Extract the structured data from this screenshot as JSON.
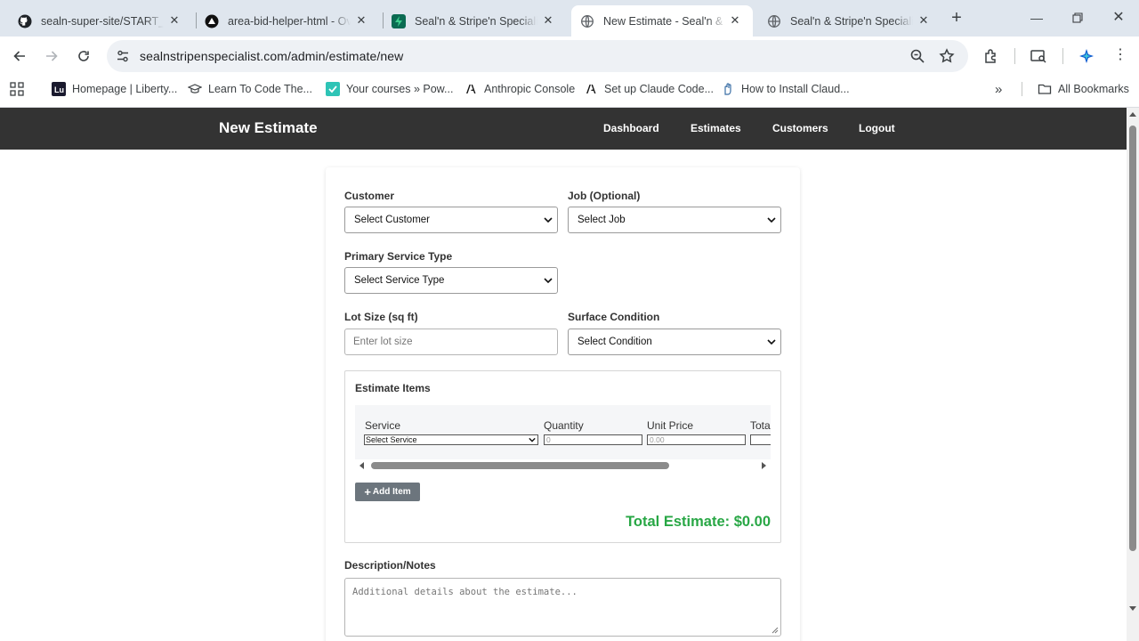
{
  "browser": {
    "tabs": [
      {
        "title": "sealn-super-site/START_TO",
        "icon": "github-icon",
        "active": false
      },
      {
        "title": "area-bid-helper-html - Ov",
        "icon": "vercel-icon",
        "active": false
      },
      {
        "title": "Seal'n & Stripe'n Specialist",
        "icon": "supabase-icon",
        "active": false
      },
      {
        "title": "New Estimate - Seal'n & St",
        "icon": "globe-icon",
        "active": true
      },
      {
        "title": "Seal'n & Stripe'n Specialist",
        "icon": "globe-icon",
        "active": false
      }
    ],
    "url": "sealnstripenspecialist.com/admin/estimate/new",
    "bookmarks": [
      {
        "label": "Homepage | Liberty...",
        "icon": "liberty-icon"
      },
      {
        "label": "Learn To Code The...",
        "icon": "graduation-cap-icon"
      },
      {
        "label": "Your courses » Pow...",
        "icon": "course-icon"
      },
      {
        "label": "Anthropic Console",
        "icon": "anthropic-icon"
      },
      {
        "label": "Set up Claude Code...",
        "icon": "anthropic-icon"
      },
      {
        "label": "How to Install Claud...",
        "icon": "hand-icon"
      }
    ],
    "all_bookmarks": "All Bookmarks"
  },
  "site": {
    "title": "New Estimate",
    "nav": [
      "Dashboard",
      "Estimates",
      "Customers",
      "Logout"
    ]
  },
  "form": {
    "customer": {
      "label": "Customer",
      "value": "Select Customer"
    },
    "job": {
      "label": "Job (Optional)",
      "value": "Select Job"
    },
    "service_type": {
      "label": "Primary Service Type",
      "value": "Select Service Type"
    },
    "lot_size": {
      "label": "Lot Size (sq ft)",
      "placeholder": "Enter lot size"
    },
    "surface": {
      "label": "Surface Condition",
      "value": "Select Condition"
    },
    "items": {
      "title": "Estimate Items",
      "columns": [
        "Service",
        "Quantity",
        "Unit Price",
        "Total"
      ],
      "row": {
        "service": "Select Service",
        "quantity": "0",
        "unit_price": "0.00"
      },
      "add_label": "Add Item",
      "total": "Total Estimate: $0.00"
    },
    "notes": {
      "label": "Description/Notes",
      "placeholder": "Additional details about the estimate..."
    }
  },
  "colors": {
    "nav_bg": "#333333",
    "total_green": "#28a745",
    "button_gray": "#6c757d"
  }
}
